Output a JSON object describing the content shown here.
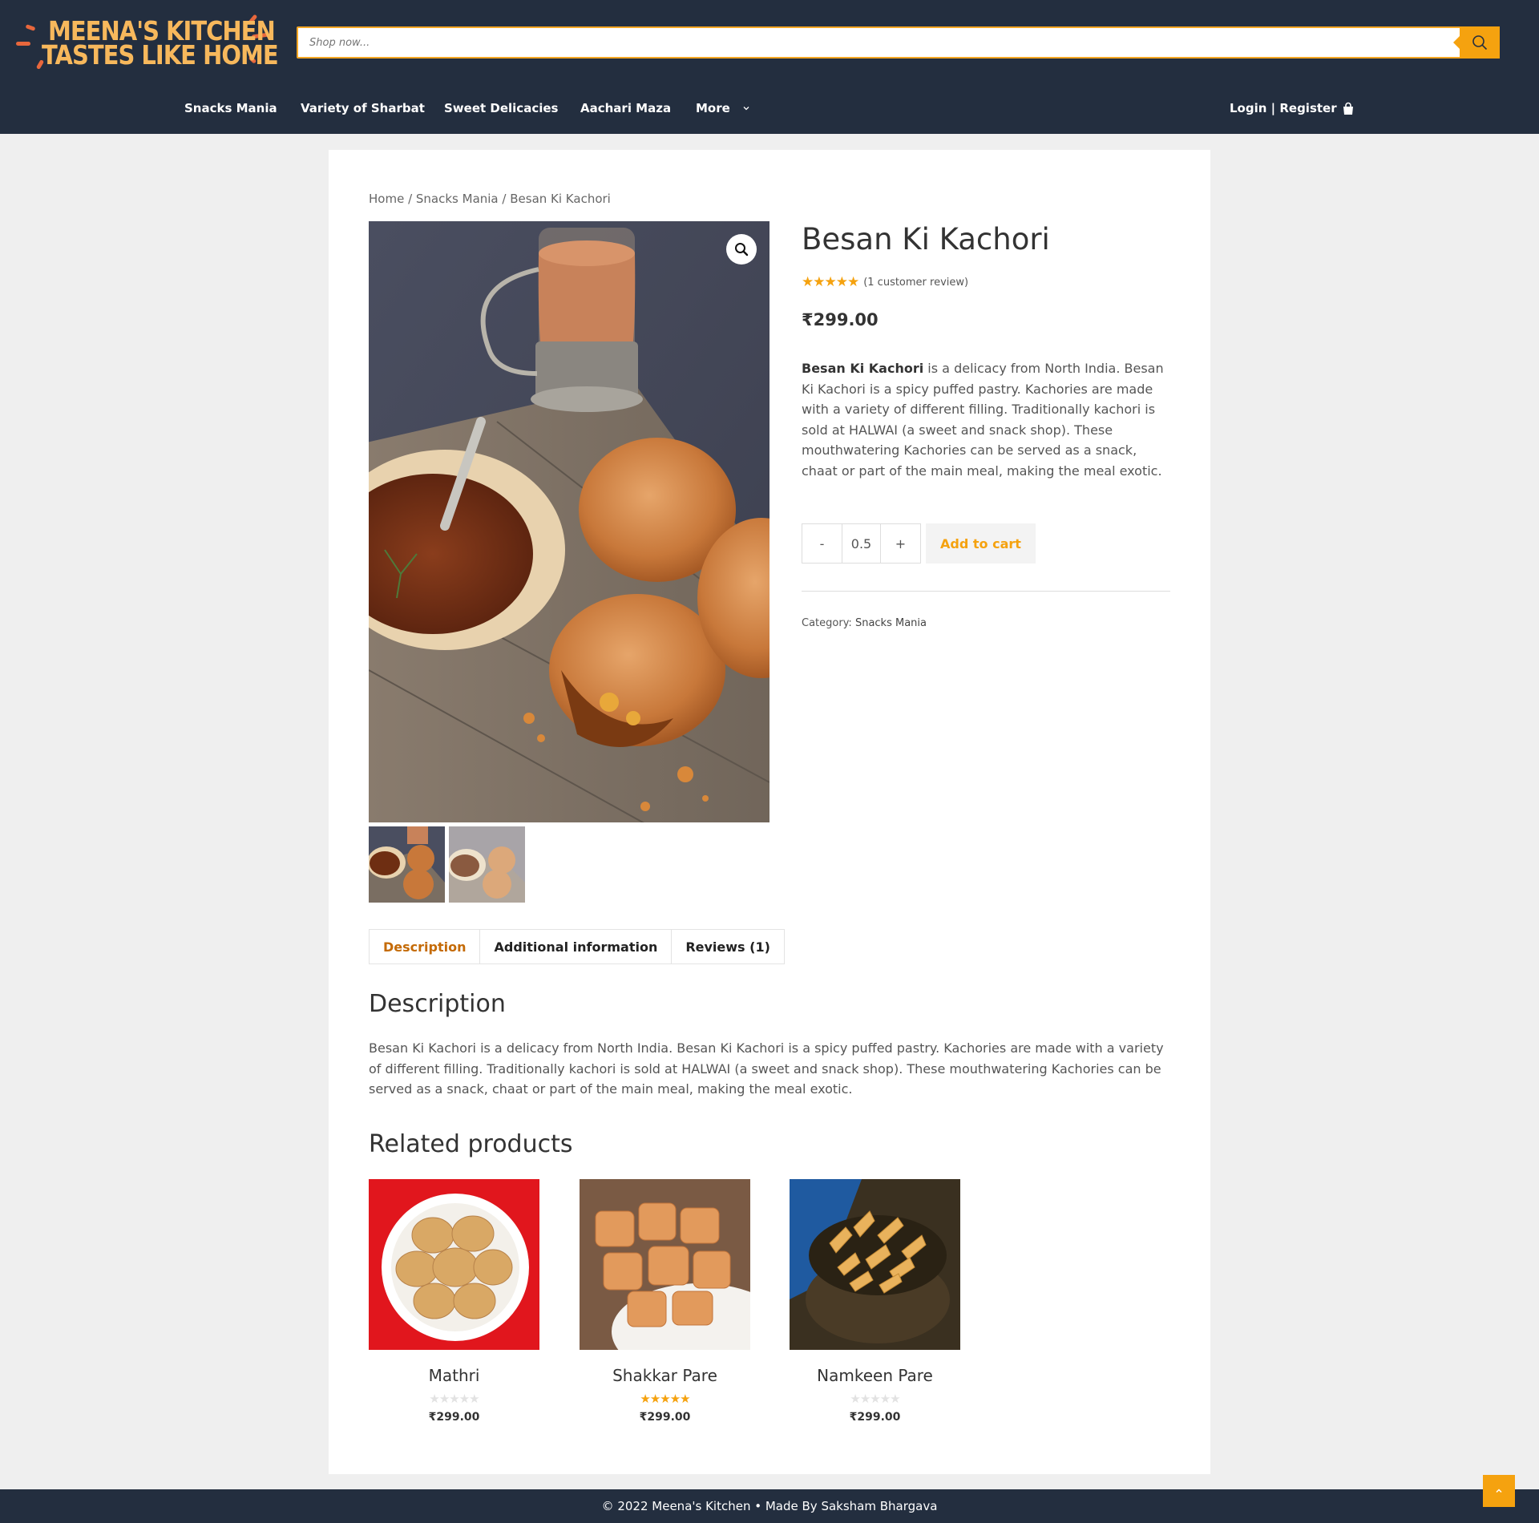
{
  "header": {
    "logo_line1": "MEENA'S KITCHEN",
    "logo_line2": "TASTES LIKE HOME",
    "search_placeholder": "Shop now...",
    "nav": [
      "Snacks Mania",
      "Variety of Sharbat",
      "Sweet Delicacies",
      "Aachari Maza",
      "More"
    ],
    "login_label": "Login | Register"
  },
  "breadcrumb": {
    "home": "Home",
    "sep1": " / ",
    "category": "Snacks Mania",
    "sep2": " / ",
    "current": "Besan Ki Kachori"
  },
  "product": {
    "title": "Besan Ki Kachori",
    "stars": "★★★★★",
    "rating": 5,
    "review_count": "(1 customer review)",
    "price": "₹299.00",
    "desc_bold": "Besan Ki Kachori",
    "desc_rest": " is a delicacy from North India. Besan Ki Kachori is a spicy puffed pastry. Kachories are made with a variety of different filling. Traditionally kachori is sold at HALWAI (a sweet and snack shop). These mouthwatering Kachories can be served as a snack, chaat or part of the main meal, making the meal exotic.",
    "qty_minus": "-",
    "qty_value": "0.5",
    "qty_plus": "+",
    "add_to_cart": "Add to cart",
    "category_label": "Category: ",
    "category_value": "Snacks Mania"
  },
  "tabs": [
    "Description",
    "Additional information",
    "Reviews (1)"
  ],
  "description": {
    "heading": "Description",
    "text": "Besan Ki Kachori is a delicacy from North India. Besan Ki Kachori is a spicy puffed pastry. Kachories are made with a variety of different filling. Traditionally kachori is sold at HALWAI (a sweet and snack shop). These mouthwatering Kachories can be served as a snack, chaat or part of the main meal, making the meal exotic."
  },
  "related": {
    "heading": "Related products",
    "items": [
      {
        "name": "Mathri",
        "stars": "★★★★★",
        "rating": 0,
        "price": "₹299.00"
      },
      {
        "name": "Shakkar Pare",
        "stars": "★★★★★",
        "rating": 5,
        "price": "₹299.00"
      },
      {
        "name": "Namkeen Pare",
        "stars": "★★★★★",
        "rating": 0,
        "price": "₹299.00"
      }
    ]
  },
  "footer": {
    "text": "© 2022 Meena's Kitchen • Made By Saksham Bhargava"
  },
  "colors": {
    "header_bg": "#232e3f",
    "accent": "#f5a20f",
    "logo": "#f7b85c",
    "active_tab": "#c46a06"
  }
}
